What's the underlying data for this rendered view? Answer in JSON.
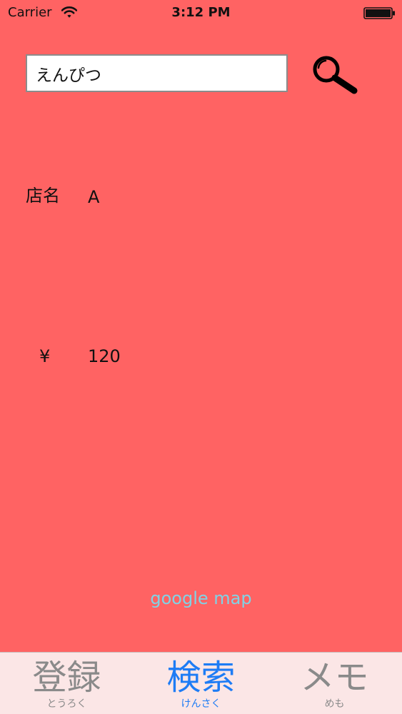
{
  "status_bar": {
    "carrier": "Carrier",
    "time": "3:12 PM"
  },
  "search": {
    "value": "えんぴつ"
  },
  "result": {
    "shop_label": "店名",
    "shop_value": "A",
    "currency_symbol": "¥",
    "price": "120"
  },
  "map_link": "google map",
  "tabs": [
    {
      "label": "登録",
      "sub": "とうろく",
      "active": false
    },
    {
      "label": "検索",
      "sub": "けんさく",
      "active": true
    },
    {
      "label": "メモ",
      "sub": "めも",
      "active": false
    }
  ],
  "colors": {
    "background": "#ff6363",
    "tab_bar": "#fbe6e6",
    "active_tab": "#1e7cf5",
    "inactive_tab": "#8a8a8a",
    "link": "#7fd3e6"
  },
  "icons": {
    "search": "magnifier-icon",
    "wifi": "wifi-icon",
    "battery": "battery-icon"
  }
}
